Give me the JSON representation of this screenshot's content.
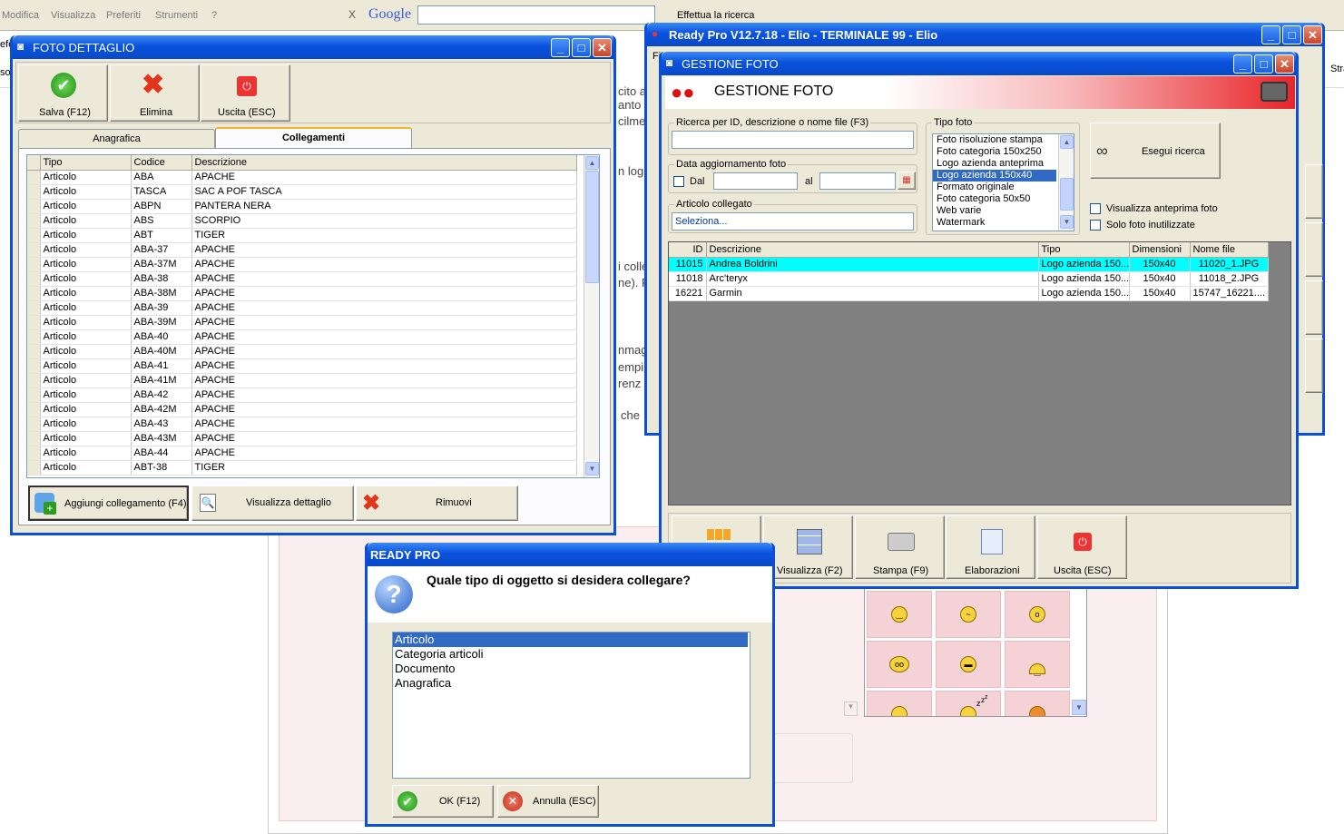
{
  "browser": {
    "menu": [
      "Modifica",
      "Visualizza",
      "Preferiti",
      "Strumenti",
      "?"
    ],
    "close_glyph": "X",
    "google": "Google",
    "search_btn": "Effettua la ricerca",
    "left_frag": [
      "efe",
      "so"
    ],
    "right_frag": "Stra"
  },
  "bg_page": {
    "fragments": [
      "cito a",
      "anto",
      "cilme",
      "n logo",
      "i colle",
      "ne). P",
      "nmag",
      "empi",
      "renz",
      "che"
    ],
    "side_letter": "Fi"
  },
  "foto_dettaglio": {
    "title": "FOTO DETTAGLIO",
    "toolbar": {
      "save": "Salva (F12)",
      "delete": "Elimina",
      "exit": "Uscita (ESC)"
    },
    "tabs": [
      "Anagrafica",
      "Collegamenti"
    ],
    "columns": [
      "Tipo",
      "Codice",
      "Descrizione"
    ],
    "rows": [
      [
        "Articolo",
        "ABA",
        "APACHE"
      ],
      [
        "Articolo",
        "TASCA",
        "SAC A POF TASCA"
      ],
      [
        "Articolo",
        "ABPN",
        "PANTERA NERA"
      ],
      [
        "Articolo",
        "ABS",
        "SCORPIO"
      ],
      [
        "Articolo",
        "ABT",
        "TIGER"
      ],
      [
        "Articolo",
        "ABA-37",
        "APACHE"
      ],
      [
        "Articolo",
        "ABA-37M",
        "APACHE"
      ],
      [
        "Articolo",
        "ABA-38",
        "APACHE"
      ],
      [
        "Articolo",
        "ABA-38M",
        "APACHE"
      ],
      [
        "Articolo",
        "ABA-39",
        "APACHE"
      ],
      [
        "Articolo",
        "ABA-39M",
        "APACHE"
      ],
      [
        "Articolo",
        "ABA-40",
        "APACHE"
      ],
      [
        "Articolo",
        "ABA-40M",
        "APACHE"
      ],
      [
        "Articolo",
        "ABA-41",
        "APACHE"
      ],
      [
        "Articolo",
        "ABA-41M",
        "APACHE"
      ],
      [
        "Articolo",
        "ABA-42",
        "APACHE"
      ],
      [
        "Articolo",
        "ABA-42M",
        "APACHE"
      ],
      [
        "Articolo",
        "ABA-43",
        "APACHE"
      ],
      [
        "Articolo",
        "ABA-43M",
        "APACHE"
      ],
      [
        "Articolo",
        "ABA-44",
        "APACHE"
      ],
      [
        "Articolo",
        "ABT-38",
        "TIGER"
      ]
    ],
    "bottom": {
      "add": "Aggiungi collegamento (F4)",
      "view": "Visualizza dettaglio",
      "remove": "Rimuovi"
    }
  },
  "ready_pro": {
    "title": "Ready Pro V12.7.18 - Elio - TERMINALE 99 - Elio"
  },
  "gestione_foto": {
    "title": "GESTIONE FOTO",
    "header": "GESTIONE FOTO",
    "search_label": "Ricerca per ID, descrizione o nome file (F3)",
    "search_value": "",
    "date_label": "Data aggiornamento foto",
    "dal": "Dal",
    "al": "al",
    "dal_value": "",
    "al_value": "",
    "articolo_label": "Articolo collegato",
    "articolo_value": "Seleziona...",
    "tipo_label": "Tipo foto",
    "tipo_options": [
      "Foto risoluzione stampa",
      "Foto categoria 150x250",
      "Logo azienda anteprima",
      "Logo azienda 150x40",
      "Formato originale",
      "Foto categoria 50x50",
      "Web varie",
      "Watermark"
    ],
    "tipo_selected": "Logo azienda 150x40",
    "search_btn": "Esegui ricerca",
    "chk_preview": "Visualizza anteprima foto",
    "chk_unused": "Solo foto inutilizzate",
    "columns": [
      "ID",
      "Descrizione",
      "Tipo",
      "Dimensioni",
      "Nome file"
    ],
    "rows": [
      [
        "11015",
        "Andrea Boldrini",
        "Logo azienda 150...",
        "150x40",
        "11020_1.JPG"
      ],
      [
        "11018",
        "Arc'teryx",
        "Logo azienda 150...",
        "150x40",
        "11018_2.JPG"
      ],
      [
        "16221",
        "Garmin",
        "Logo azienda 150...",
        "150x40",
        "15747_16221...."
      ]
    ],
    "bottom": {
      "view": "Visualizza (F2)",
      "print": "Stampa (F9)",
      "elab": "Elaborazioni",
      "exit": "Uscita (ESC)"
    }
  },
  "dialog": {
    "title": "READY PRO",
    "question": "Quale tipo di oggetto si desidera collegare?",
    "options": [
      "Articolo",
      "Categoria articoli",
      "Documento",
      "Anagrafica"
    ],
    "ok": "OK (F12)",
    "cancel": "Annulla (ESC)"
  },
  "emoticons": {
    "row2": [
      "z",
      "z",
      "z"
    ]
  },
  "colors": {
    "accent": "#0a52de",
    "selection": "#316ac5",
    "highlight_row": "#00ffff",
    "header_red": "#e8252a"
  }
}
